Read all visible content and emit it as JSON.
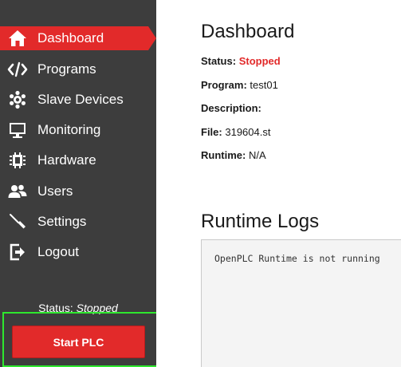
{
  "sidebar": {
    "items": [
      {
        "label": "Dashboard",
        "icon": "home-icon",
        "active": true
      },
      {
        "label": "Programs",
        "icon": "code-icon",
        "active": false
      },
      {
        "label": "Slave Devices",
        "icon": "gear-cluster-icon",
        "active": false
      },
      {
        "label": "Monitoring",
        "icon": "monitor-icon",
        "active": false
      },
      {
        "label": "Hardware",
        "icon": "chip-icon",
        "active": false
      },
      {
        "label": "Users",
        "icon": "users-icon",
        "active": false
      },
      {
        "label": "Settings",
        "icon": "screwdriver-icon",
        "active": false
      },
      {
        "label": "Logout",
        "icon": "logout-icon",
        "active": false
      }
    ],
    "status_label": "Status:",
    "status_value": "Stopped",
    "start_button_label": "Start PLC"
  },
  "main": {
    "title": "Dashboard",
    "info": {
      "status_key": "Status:",
      "status_value": "Stopped",
      "program_key": "Program:",
      "program_value": "test01",
      "description_key": "Description:",
      "description_value": "",
      "file_key": "File:",
      "file_value": "319604.st",
      "runtime_key": "Runtime:",
      "runtime_value": "N/A"
    },
    "logs_title": "Runtime Logs",
    "logs_text": "OpenPLC Runtime is not running"
  },
  "colors": {
    "sidebar_bg": "#3d3d3d",
    "accent": "#e22a2a",
    "highlight_border": "#2ee82e"
  }
}
